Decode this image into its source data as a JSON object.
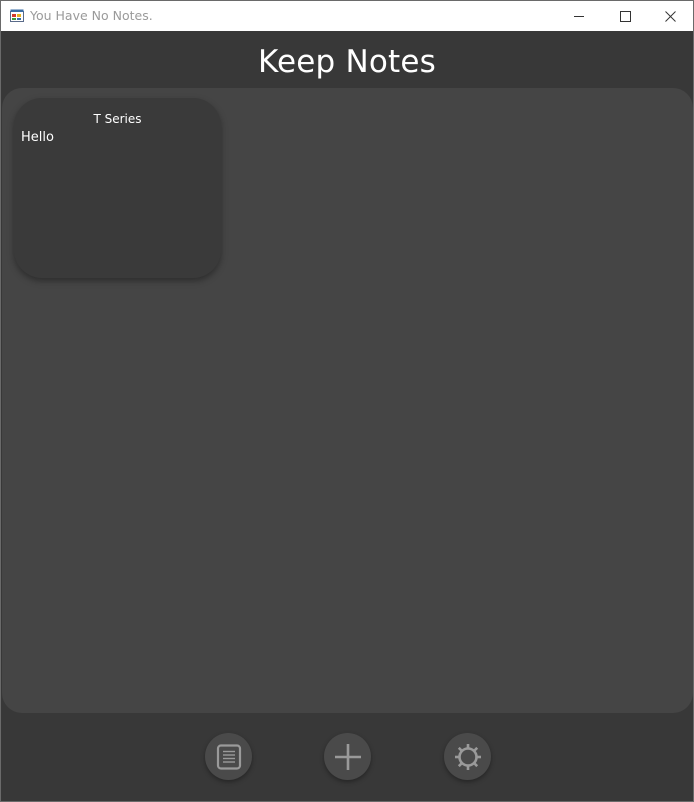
{
  "window": {
    "title": "You Have No Notes.",
    "controls": {
      "minimize_icon": "minimize-icon",
      "maximize_icon": "maximize-icon",
      "close_icon": "close-icon"
    }
  },
  "app": {
    "title": "Keep Notes"
  },
  "notes": [
    {
      "title": "T Series",
      "body": "Hello"
    }
  ],
  "toolbar": {
    "buttons": [
      {
        "icon": "notes-list-icon"
      },
      {
        "icon": "plus-icon"
      },
      {
        "icon": "gear-icon"
      }
    ]
  },
  "colors": {
    "background": "#383838",
    "panel": "#454545",
    "card": "#3a3a3a",
    "button": "#4a4a4a",
    "icon": "#9a9a9a",
    "text": "#ffffff"
  }
}
